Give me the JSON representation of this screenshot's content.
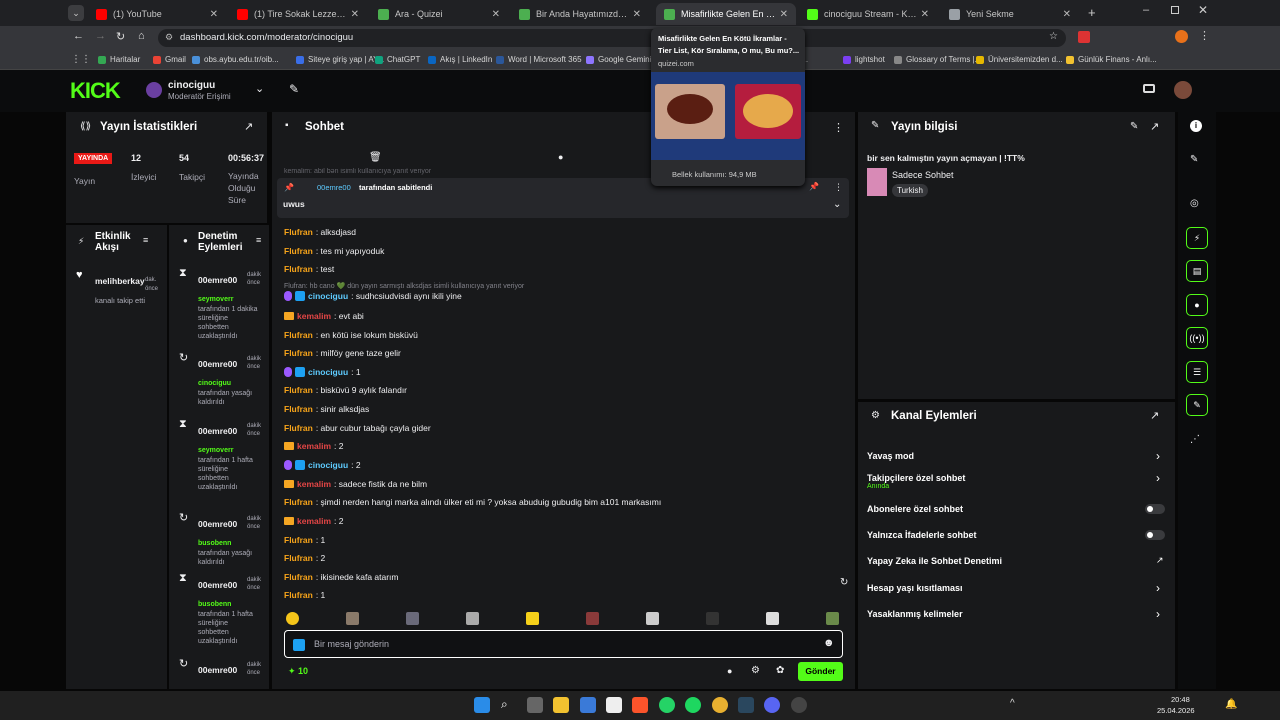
{
  "browser": {
    "tabs": [
      {
        "title": "(1) YouTube",
        "color": "#ff0000"
      },
      {
        "title": "(1) Tire Sokak Lezzetleri | Vlog",
        "color": "#ff0000"
      },
      {
        "title": "Ara - Quizei",
        "color": "#4caf50"
      },
      {
        "title": "Bir Anda Hayatımızdan Çıkan A",
        "color": "#4caf50"
      },
      {
        "title": "Misafirlikte Gelen En Kötü İkram",
        "color": "#4caf50",
        "active": true
      },
      {
        "title": "cinociguu Stream - Kick Dashb",
        "color": "#53fc18"
      },
      {
        "title": "Yeni Sekme",
        "color": "#9aa0a6"
      }
    ],
    "url": "dashboard.kick.com/moderator/cinociguu",
    "bookmarks": [
      "Haritalar",
      "Gmail",
      "obs.aybu.edu.tr/oib...",
      "Siteye giriş yap | AY...",
      "ChatGPT",
      "Akış | LinkedIn",
      "Word | Microsoft 365",
      "Google Gemini",
      "To...",
      "lightshot",
      "Glossary of Terms |...",
      "Üniversitemizden d...",
      "Günlük Finans - Anlı..."
    ],
    "tooltip": {
      "title": "Misafirlikte Gelen En Kötü İkramlar - Tier List, Kör Sıralama, O mu, Bu mu?...",
      "domain": "quizei.com",
      "memory": "Bellek kullanımı: 94,9 MB"
    }
  },
  "header": {
    "logo": "KICK",
    "channel": "cinociguu",
    "role": "Moderatör Erişimi"
  },
  "stats": {
    "title": "Yayın İstatistikleri",
    "live": "YAYINDA",
    "live_label": "Yayın",
    "viewers": "12",
    "viewers_label": "İzleyici",
    "followers": "54",
    "followers_label": "Takipçi",
    "duration": "00:56:37",
    "duration_label": "Yayında Olduğu Süre"
  },
  "activity": {
    "title": "Etkinlik Akışı",
    "user": "melihberkay",
    "suffix": "dak. önce",
    "text": "kanalı takip etti"
  },
  "modlog": {
    "title": "Denetim Eylemleri",
    "entries": [
      {
        "user": "00emre00",
        "time": "dakika önce",
        "actor": "seymoverr",
        "desc": "tarafından 1 dakika süreliğine sohbetten uzaklaştırıldı"
      },
      {
        "user": "00emre00",
        "time": "dakika önce",
        "actor": "cinociguu",
        "desc": "tarafından yasağı kaldırıldı"
      },
      {
        "user": "00emre00",
        "time": "dakika önce",
        "actor": "seymoverr",
        "desc": "tarafından 1 hafta süreliğine sohbetten uzaklaştırıldı"
      },
      {
        "user": "00emre00",
        "time": "dakika önce",
        "actor": "busobenn",
        "desc": "tarafından yasağı kaldırıldı"
      },
      {
        "user": "00emre00",
        "time": "dakika önce",
        "actor": "busobenn",
        "desc": "tarafından 1 hafta süreliğine sohbetten uzaklaştırıldı"
      },
      {
        "user": "00emre00",
        "time": "dakika önce",
        "actor": "",
        "desc": ""
      }
    ]
  },
  "chat": {
    "title": "Sohbet",
    "pinned_by": "00emre00",
    "pinned_suffix": "tarafından sabitlendi",
    "pinned_text": "uwus",
    "faded_top": "kemalim: abil bən isimli kullanıcıya yanıt veriyor",
    "reply_hint": "Flufran: hb cano 💚 dün yayın sarmıştı alksdjas isimli kullanıcıya yanıt veriyor",
    "messages": [
      {
        "user": "Flufran",
        "cls": "uo",
        "badge": "",
        "text": "alksdjasd"
      },
      {
        "user": "Flufran",
        "cls": "uo",
        "badge": "",
        "text": "tes mi yapıyoduk"
      },
      {
        "user": "Flufran",
        "cls": "uo",
        "badge": "",
        "text": "test"
      },
      {
        "user": "cinociguu",
        "cls": "ub",
        "badge": "mk",
        "text": "sudhcsiudvisdi aynı ikili yine"
      },
      {
        "user": "kemalim",
        "cls": "ur",
        "badge": "c",
        "text": "evt abi"
      },
      {
        "user": "Flufran",
        "cls": "uo",
        "badge": "",
        "text": "en kötü ise lokum bisküvü"
      },
      {
        "user": "Flufran",
        "cls": "uo",
        "badge": "",
        "text": "milföy gene taze gelir"
      },
      {
        "user": "cinociguu",
        "cls": "ub",
        "badge": "mk",
        "text": "1"
      },
      {
        "user": "Flufran",
        "cls": "uo",
        "badge": "",
        "text": "bisküvü 9 aylık falandır"
      },
      {
        "user": "Flufran",
        "cls": "uo",
        "badge": "",
        "text": "sinir alksdjas"
      },
      {
        "user": "Flufran",
        "cls": "uo",
        "badge": "",
        "text": "abur cubur tabağı çayla gider"
      },
      {
        "user": "kemalim",
        "cls": "ur",
        "badge": "c",
        "text": "2"
      },
      {
        "user": "cinociguu",
        "cls": "ub",
        "badge": "mk",
        "text": "2"
      },
      {
        "user": "kemalim",
        "cls": "ur",
        "badge": "c",
        "text": "sadece fistik da ne bilm"
      },
      {
        "user": "Flufran",
        "cls": "uo",
        "badge": "",
        "text": "şimdi nerden hangi marka alındı ülker eti mi ? yoksa abuduig gubudig bim a101 markasımı"
      },
      {
        "user": "kemalim",
        "cls": "ur",
        "badge": "c",
        "text": "2"
      },
      {
        "user": "Flufran",
        "cls": "uo",
        "badge": "",
        "text": "1"
      },
      {
        "user": "Flufran",
        "cls": "uo",
        "badge": "",
        "text": "2"
      },
      {
        "user": "Flufran",
        "cls": "uo",
        "badge": "",
        "text": "ikisinede kafa atarım"
      },
      {
        "user": "Flufran",
        "cls": "uo",
        "badge": "",
        "text": "1"
      }
    ],
    "input_placeholder": "Bir mesaj gönderin",
    "points": "10",
    "send": "Gönder"
  },
  "info": {
    "title": "Yayın bilgisi",
    "stream_title": "bir sen kalmıştın yayın açmayan | !TT%",
    "category": "Sadece Sohbet",
    "language": "Turkish"
  },
  "actions": {
    "title": "Kanal Eylemleri",
    "items": [
      {
        "label": "Yavaş mod",
        "kind": "chev"
      },
      {
        "label": "Takipçilere özel sohbet",
        "sub": "Anında",
        "kind": "chev"
      },
      {
        "label": "Abonelere özel sohbet",
        "kind": "toggle"
      },
      {
        "label": "Yalnızca İfadelerle sohbet",
        "kind": "toggle"
      },
      {
        "label": "Yapay Zeka ile Sohbet Denetimi",
        "kind": "ext"
      },
      {
        "label": "Hesap yaşı kısıtlaması",
        "kind": "chev"
      },
      {
        "label": "Yasaklanmış kelimeler",
        "kind": "chev"
      }
    ]
  },
  "taskbar": {
    "time": "20:48",
    "date": "25.04.2026"
  }
}
